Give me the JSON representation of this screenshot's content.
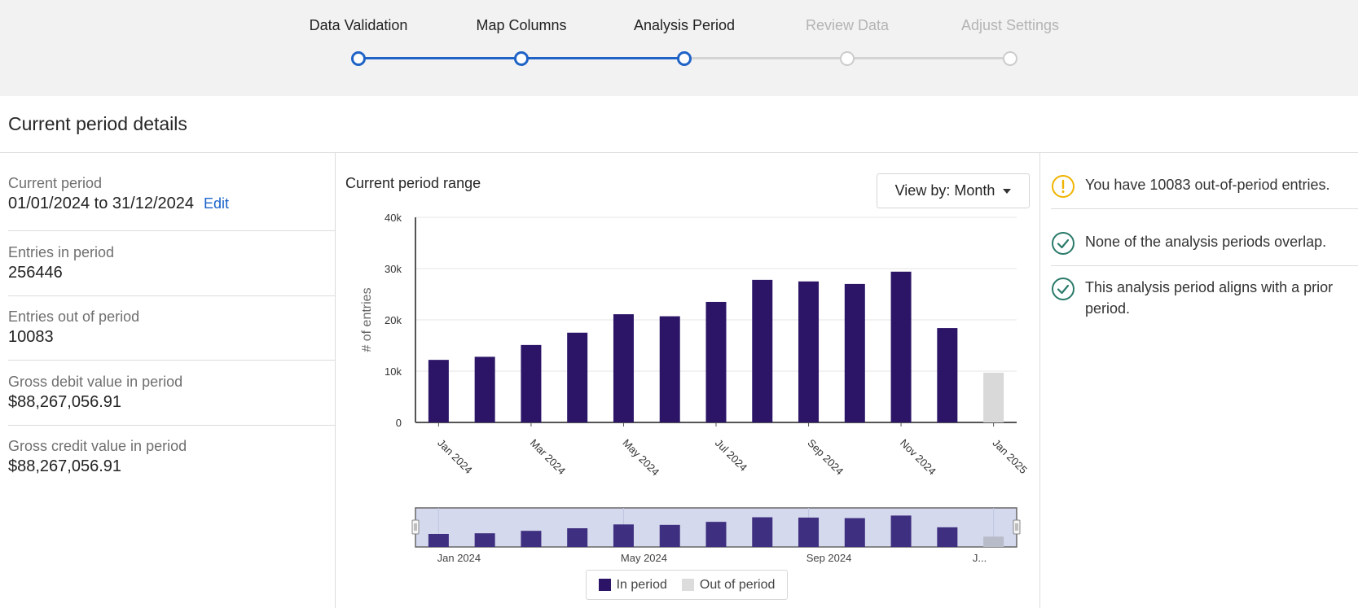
{
  "stepper": {
    "steps": [
      {
        "label": "Data Validation",
        "state": "done"
      },
      {
        "label": "Map Columns",
        "state": "done"
      },
      {
        "label": "Analysis Period",
        "state": "current"
      },
      {
        "label": "Review Data",
        "state": "todo"
      },
      {
        "label": "Adjust Settings",
        "state": "todo"
      }
    ]
  },
  "page_title": "Current period details",
  "stats": {
    "current_period": {
      "label": "Current period",
      "value": "01/01/2024 to 31/12/2024",
      "edit": "Edit"
    },
    "entries_in": {
      "label": "Entries in period",
      "value": "256446"
    },
    "entries_out": {
      "label": "Entries out of period",
      "value": "10083"
    },
    "gross_debit": {
      "label": "Gross debit value in period",
      "value": "$88,267,056.91"
    },
    "gross_credit": {
      "label": "Gross credit value in period",
      "value": "$88,267,056.91"
    }
  },
  "chart_panel": {
    "title": "Current period range",
    "view_by": "View by: Month"
  },
  "chart_data": {
    "type": "bar",
    "ylabel": "# of entries",
    "xlabel": "",
    "ylim": [
      0,
      40000
    ],
    "yticks": [
      "0",
      "10k",
      "20k",
      "30k",
      "40k"
    ],
    "xtick_labels": [
      "Jan 2024",
      "Mar 2024",
      "May 2024",
      "Jul 2024",
      "Sep 2024",
      "Nov 2024",
      "Jan 2025"
    ],
    "categories": [
      "Jan 2024",
      "Feb 2024",
      "Mar 2024",
      "Apr 2024",
      "May 2024",
      "Jun 2024",
      "Jul 2024",
      "Aug 2024",
      "Sep 2024",
      "Oct 2024",
      "Nov 2024",
      "Dec 2024",
      "Jan 2025"
    ],
    "series": [
      {
        "name": "In period",
        "color": "#2c1567",
        "values": [
          12200,
          12800,
          15100,
          17500,
          21100,
          20700,
          23500,
          27800,
          27500,
          27000,
          29400,
          18400,
          null
        ]
      },
      {
        "name": "Out of period",
        "color": "#d9d9d9",
        "values": [
          null,
          null,
          null,
          null,
          null,
          null,
          null,
          null,
          null,
          null,
          null,
          null,
          9700
        ]
      }
    ],
    "grid": true,
    "legend": "bottom",
    "navigator_labels": [
      "Jan 2024",
      "May 2024",
      "Sep 2024",
      "J..."
    ]
  },
  "messages": [
    {
      "icon": "warning-icon",
      "text": "You have 10083 out-of-period entries."
    },
    {
      "icon": "check-circle-icon",
      "text": "None of the analysis periods overlap."
    },
    {
      "icon": "check-circle-icon",
      "text": "This analysis period aligns with a prior period."
    }
  ],
  "colors": {
    "accent": "#1f63c6",
    "in_period": "#2c1567",
    "out_period": "#d9d9d9",
    "warning": "#f0b400",
    "success": "#2a7a6a"
  }
}
